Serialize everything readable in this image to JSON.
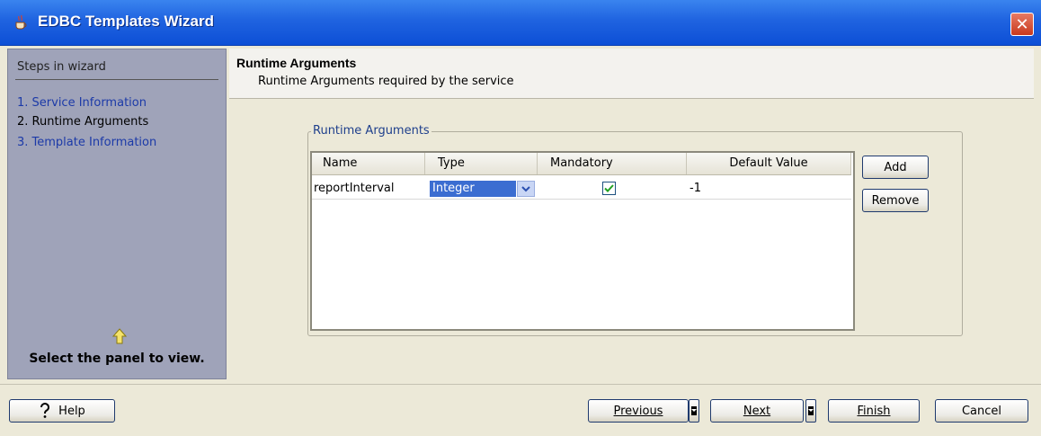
{
  "window": {
    "title": "EDBC Templates Wizard",
    "app_icon": "java-cup-icon",
    "close_icon": "close-icon"
  },
  "steps": {
    "header": "Steps in wizard",
    "items": [
      {
        "label": "1. Service Information",
        "state": "link"
      },
      {
        "label": "2. Runtime Arguments",
        "state": "current"
      },
      {
        "label": "3. Template Information",
        "state": "link"
      }
    ],
    "hint_icon": "up-arrow-icon",
    "hint": "Select the panel to view."
  },
  "panel": {
    "title": "Runtime Arguments",
    "subtitle": "Runtime Arguments required by the service"
  },
  "group": {
    "legend": "Runtime Arguments"
  },
  "table": {
    "columns": [
      "Name",
      "Type",
      "Mandatory",
      "Default Value"
    ],
    "rows": [
      {
        "name": "reportInterval",
        "type": "Integer",
        "mandatory": true,
        "default": "-1"
      }
    ]
  },
  "side_buttons": {
    "add": "Add",
    "remove": "Remove"
  },
  "footer": {
    "help": "Help",
    "help_icon": "question-mark-icon",
    "previous": "Previous",
    "next": "Next",
    "finish": "Finish",
    "cancel": "Cancel"
  },
  "colors": {
    "titlebar": "#1f63e0",
    "left_panel": "#9fa3b9",
    "selection": "#3b6dd1",
    "link": "#1c3aa8"
  }
}
